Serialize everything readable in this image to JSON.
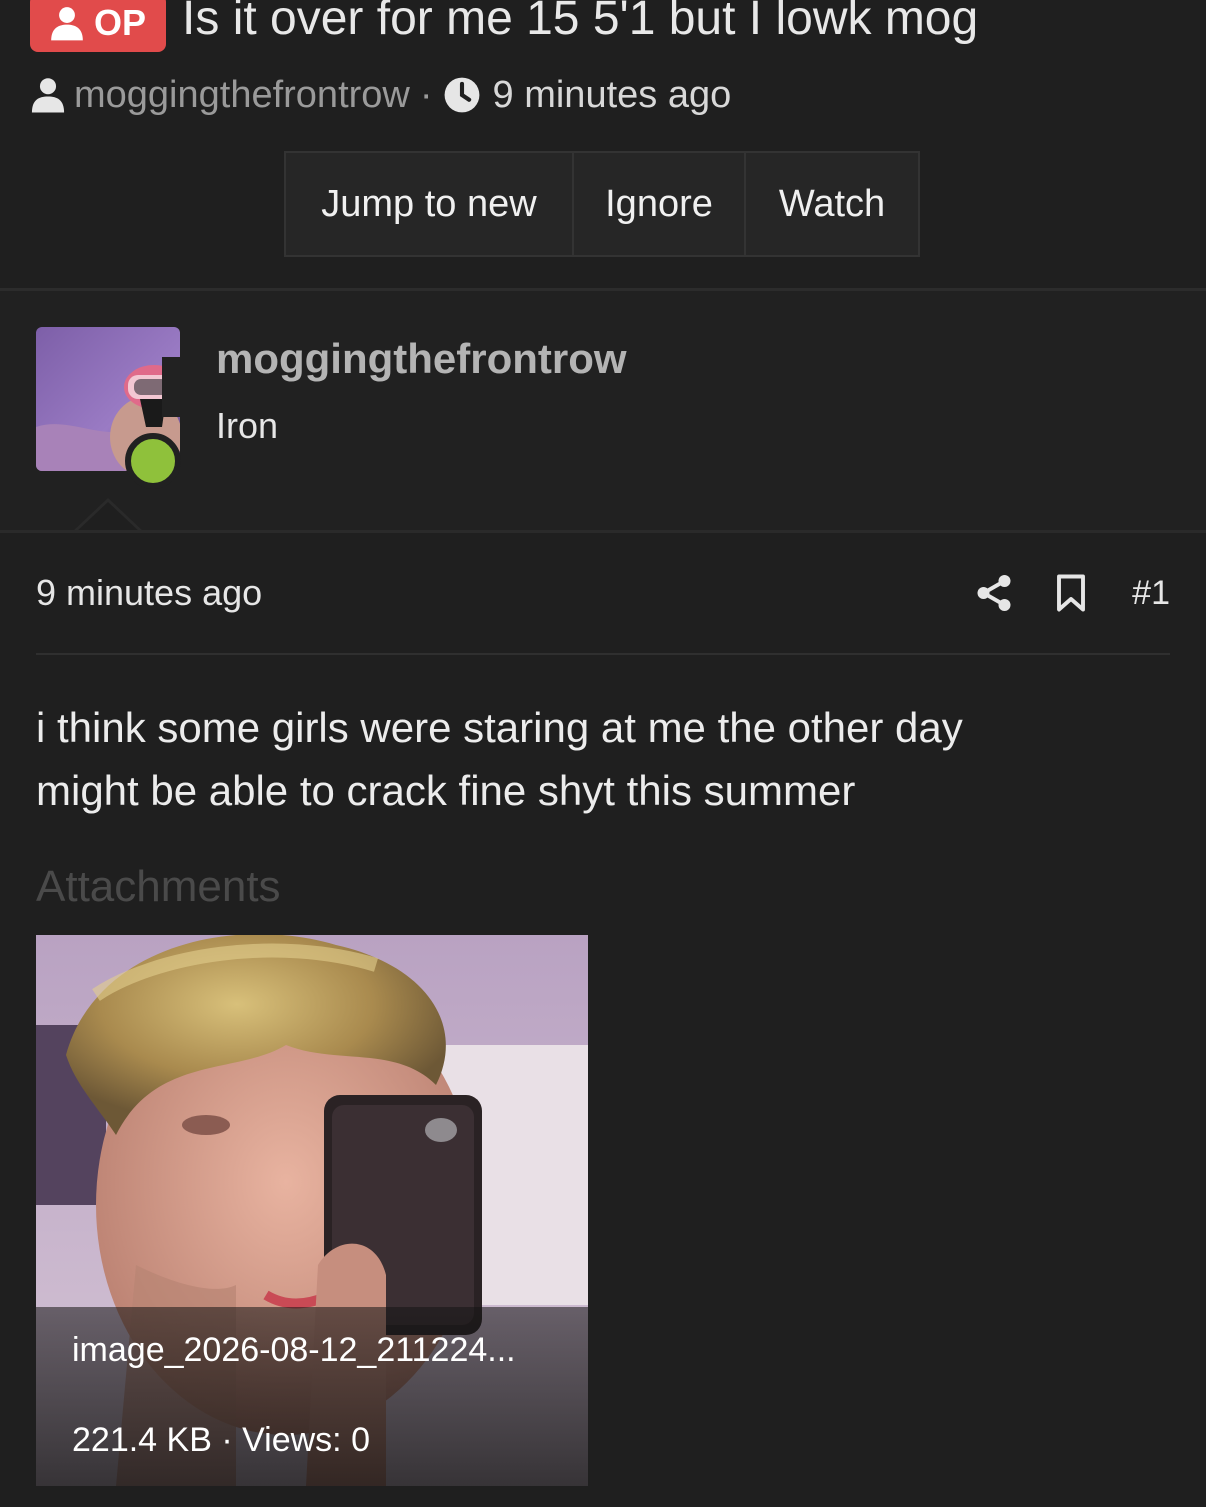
{
  "thread": {
    "op_badge": "OP",
    "title": "Is it over for me 15 5'1 but I lowk mog",
    "author": "moggingthefrontrow",
    "separator": "·",
    "time_ago": "9 minutes ago"
  },
  "actions": {
    "jump_label": "Jump to new",
    "ignore_label": "Ignore",
    "watch_label": "Watch"
  },
  "user": {
    "name": "moggingthefrontrow",
    "title": "Iron",
    "online": true
  },
  "post": {
    "time_ago": "9 minutes ago",
    "number": "#1",
    "body_lines": [
      "i think some girls were staring at me the other day",
      "might be able to crack fine shyt this summer"
    ]
  },
  "attachments": {
    "label": "Attachments",
    "items": [
      {
        "filename": "image_2026-08-12_211224...",
        "stats": "221.4 KB · Views: 0"
      }
    ]
  },
  "colors": {
    "background": "#1f1f1f",
    "op_badge": "#e14b4b",
    "online": "#8fc13b",
    "muted": "#9a9a9a"
  },
  "icons": [
    "user-icon",
    "clock-icon",
    "share-icon",
    "bookmark-icon"
  ]
}
